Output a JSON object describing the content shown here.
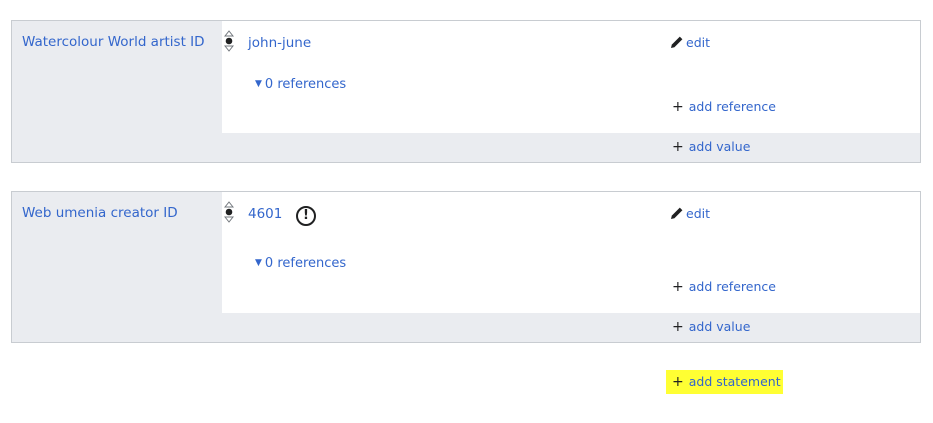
{
  "statements": [
    {
      "property": "Watercolour World artist ID",
      "value": "john-june",
      "has_warning": false,
      "edit_label": "edit",
      "references_label": "0 references",
      "add_reference_label": "add reference",
      "add_value_label": "add value"
    },
    {
      "property": "Web umenia creator ID",
      "value": "4601",
      "has_warning": true,
      "warning_glyph": "!",
      "edit_label": "edit",
      "references_label": "0 references",
      "add_reference_label": "add reference",
      "add_value_label": "add value"
    }
  ],
  "add_statement_label": "add statement",
  "icons": {
    "plus": "+",
    "caret": "▼",
    "edit": "pencil-icon",
    "rank": "rank-selector-icon",
    "warning": "exclamation-circle-icon"
  },
  "colors": {
    "link": "#3366cc",
    "group_bg": "#eaecf0",
    "border": "#c8ccd1",
    "highlight": "#ffff33"
  }
}
